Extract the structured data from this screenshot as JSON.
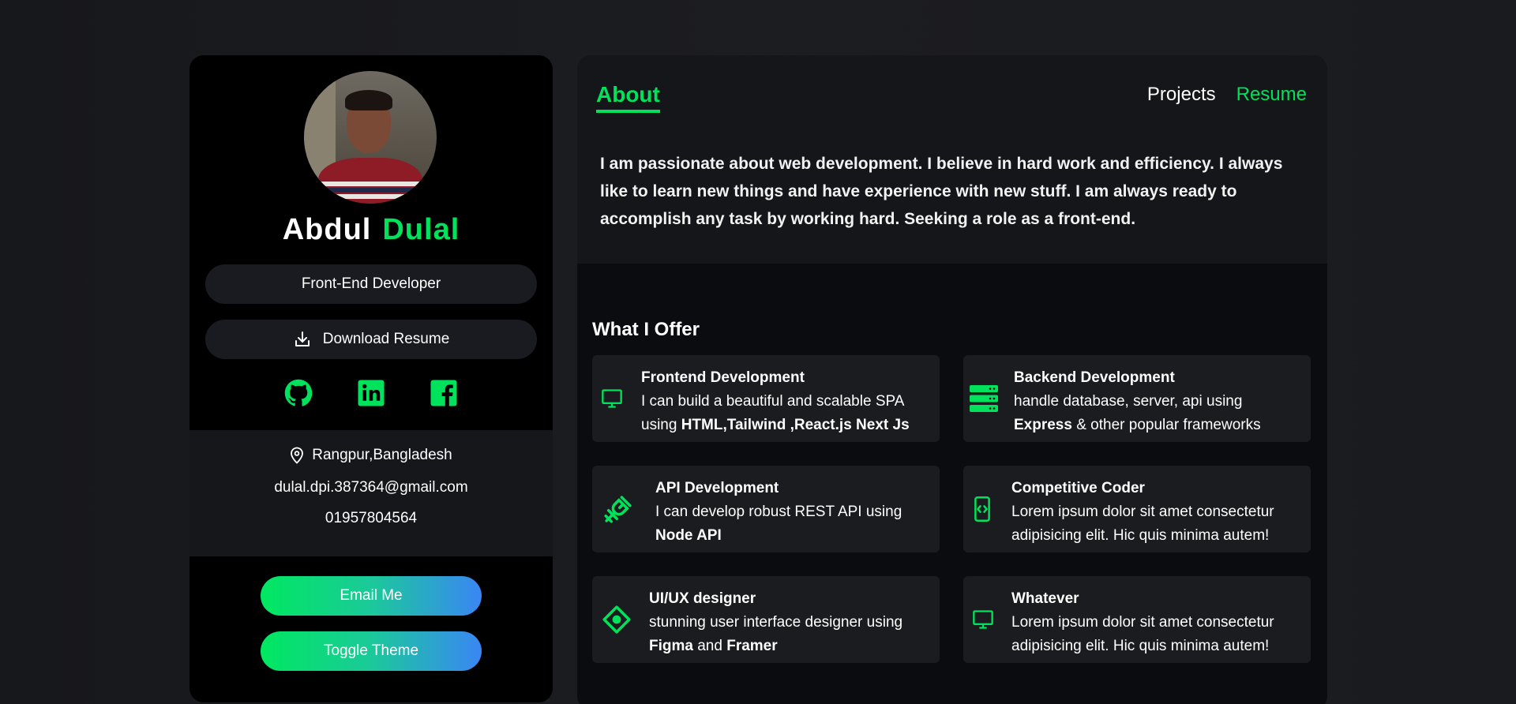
{
  "profile": {
    "first_name": "Abdul",
    "last_name": "Dulal",
    "role": "Front-End Developer",
    "download_label": "Download Resume",
    "location": "Rangpur,Bangladesh",
    "email": "dulal.dpi.387364@gmail.com",
    "phone": "01957804564",
    "email_button": "Email Me",
    "theme_button": "Toggle Theme",
    "socials": [
      "github-icon",
      "linkedin-icon",
      "facebook-icon"
    ]
  },
  "nav": {
    "about": "About",
    "projects": "Projects",
    "resume": "Resume"
  },
  "about": {
    "text": "I am passionate about web development. I believe in hard work and efficiency. I always like to learn new things and have experience with new stuff. I am always ready to accomplish any task by working hard. Seeking a role as a front-end."
  },
  "offer": {
    "title": "What I Offer",
    "cards": [
      {
        "title": "Frontend Development",
        "line1": "I can build a beautiful and scalable SPA",
        "line2_pre": "using ",
        "line2_bold": "HTML,Tailwind ,React.js Next Js",
        "icon": "monitor-icon"
      },
      {
        "title": "Backend Development",
        "line1": "handle database, server, api using",
        "line2_bold": "Express",
        "line2_post": " & other popular frameworks",
        "icon": "server-icon"
      },
      {
        "title": "API Development",
        "line1": "I can develop robust REST API using",
        "line2_bold": "Node API",
        "icon": "plug-icon"
      },
      {
        "title": "Competitive Coder",
        "line1": "Lorem ipsum dolor sit amet consectetur",
        "line2": "adipisicing elit. Hic quis minima autem!",
        "icon": "mobile-code-icon"
      },
      {
        "title": "UI/UX designer",
        "line1": "stunning user interface designer using",
        "line2_bold_a": "Figma",
        "line2_mid": " and ",
        "line2_bold_b": "Framer",
        "icon": "pen-tool-icon"
      },
      {
        "title": "Whatever",
        "line1": "Lorem ipsum dolor sit amet consectetur",
        "line2": "adipisicing elit. Hic quis minima autem!",
        "icon": "monitor-icon"
      }
    ]
  },
  "colors": {
    "accent": "#00e25b",
    "gradient_start": "#00e860",
    "gradient_end": "#3a86f4",
    "card_bg": "#1b1c20"
  }
}
